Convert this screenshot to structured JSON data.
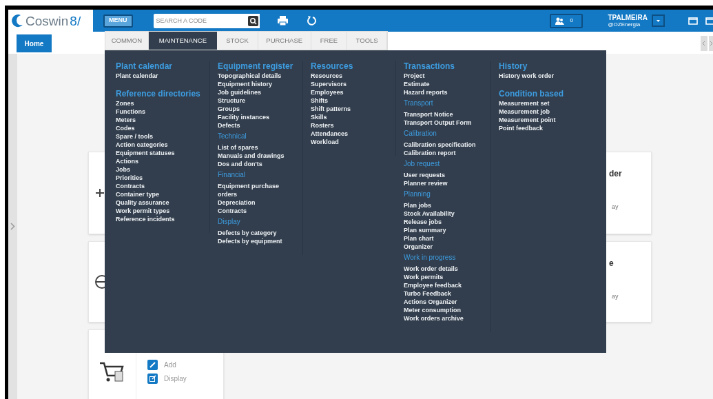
{
  "header": {
    "logo": "Coswin",
    "logo_suffix": "8/",
    "menu_button": "MENU",
    "search": {
      "placeholder": "SEARCH A CODE"
    },
    "notifications": "0",
    "user": {
      "name": "TPALMEIRA",
      "org": "@OZEnergia"
    }
  },
  "home_tab": "Home",
  "menu": {
    "tabs": [
      {
        "label": "COMMON",
        "selected": false
      },
      {
        "label": "MAINTENANCE",
        "selected": true
      },
      {
        "label": "STOCK",
        "selected": false
      },
      {
        "label": "PURCHASE",
        "selected": false
      },
      {
        "label": "FREE",
        "selected": false
      },
      {
        "label": "TOOLS",
        "selected": false
      }
    ],
    "columns": [
      {
        "groups": [
          {
            "heading": "Plant calendar",
            "kind": "major",
            "items": [
              "Plant calendar"
            ]
          },
          {
            "heading": "Reference directories",
            "kind": "major",
            "items": [
              "Zones",
              "Functions",
              "Meters",
              "Codes",
              "Spare / tools",
              "Action categories",
              "Equipment statuses",
              "Actions",
              "Jobs",
              "Priorities",
              "Contracts",
              "Container type",
              "Quality assurance",
              "Work permit types",
              "Reference incidents"
            ]
          }
        ]
      },
      {
        "groups": [
          {
            "heading": "Equipment register",
            "kind": "major",
            "items": [
              "Topographical details",
              "Equipment history",
              "Job guidelines",
              "Structure",
              "Groups",
              "Facility instances",
              "Defects"
            ]
          },
          {
            "heading": "Technical",
            "kind": "minor",
            "items": [
              "List of spares",
              "Manuals and drawings",
              "Dos and don'ts"
            ]
          },
          {
            "heading": "Financial",
            "kind": "minor",
            "items": [
              "Equipment purchase orders",
              "Depreciation",
              "Contracts"
            ]
          },
          {
            "heading": "Display",
            "kind": "minor",
            "items": [
              "Defects by category",
              "Defects by equipment"
            ]
          }
        ]
      },
      {
        "groups": [
          {
            "heading": "Resources",
            "kind": "major",
            "items": [
              "Resources",
              "Supervisors",
              "Employees",
              "Shifts",
              "Shift patterns",
              "Skills",
              "Rosters",
              "Attendances",
              "Workload"
            ]
          }
        ]
      },
      {
        "groups": [
          {
            "heading": "Transactions",
            "kind": "major",
            "items": [
              "Project",
              "Estimate",
              "Hazard reports"
            ]
          },
          {
            "heading": "Transport",
            "kind": "minor",
            "items": [
              "Transport Notice",
              "Transport Output Form"
            ]
          },
          {
            "heading": "Calibration",
            "kind": "minor",
            "items": [
              "Calibration specification",
              "Calibration report"
            ]
          },
          {
            "heading": "Job request",
            "kind": "minor",
            "items": [
              "User requests",
              "Planner review"
            ]
          },
          {
            "heading": "Planning",
            "kind": "minor",
            "items": [
              "Plan jobs",
              "Stock Availability",
              "Release jobs",
              "Plan summary",
              "Plan chart",
              "Organizer"
            ]
          },
          {
            "heading": "Work in progress",
            "kind": "minor",
            "items": [
              "Work order details",
              "Work permits",
              "Employee feedback",
              "Turbo Feedback",
              "Actions Organizer",
              "Meter consumption",
              "Work orders archive"
            ]
          }
        ]
      },
      {
        "groups": [
          {
            "heading": "History",
            "kind": "major",
            "items": [
              "History work order"
            ]
          },
          {
            "heading": "Condition based",
            "kind": "major",
            "items": [
              "Measurement set",
              "Measurement job",
              "Measurement point",
              "Point feedback"
            ]
          }
        ]
      }
    ]
  },
  "cards": [
    {
      "title": "der",
      "link": "ay"
    },
    {
      "title": "e",
      "link": "ay"
    }
  ],
  "purchase_card": {
    "actions": [
      {
        "label": "Add",
        "kind": "add"
      },
      {
        "label": "Display",
        "kind": "display"
      }
    ]
  }
}
